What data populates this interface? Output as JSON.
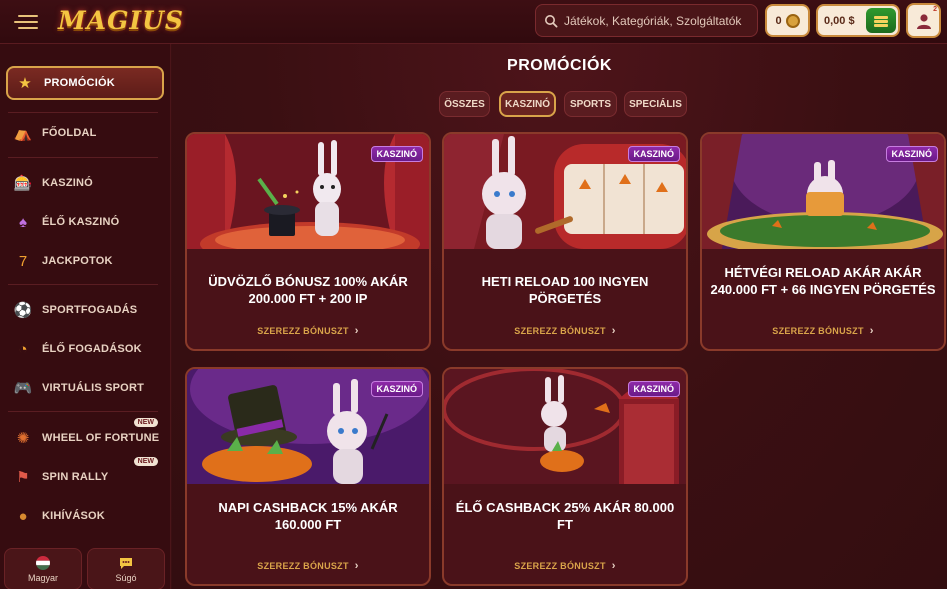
{
  "header": {
    "logo_text": "MAGIUS",
    "search_placeholder": "Játékok, Kategóriák, Szolgáltatók",
    "coins_value": "0",
    "balance": "0,00 $",
    "notification_count": "2"
  },
  "sidebar": {
    "items": [
      {
        "label": "PROMÓCIÓK",
        "icon": "star-hat-icon"
      },
      {
        "label": "FŐOLDAL",
        "icon": "tent-icon"
      },
      {
        "label": "KASZINÓ",
        "icon": "slot-icon"
      },
      {
        "label": "ÉLŐ KASZINÓ",
        "icon": "dealer-icon"
      },
      {
        "label": "JACKPOTOK",
        "icon": "jackpot-icon"
      },
      {
        "label": "SPORTFOGADÁS",
        "icon": "sport-icon"
      },
      {
        "label": "ÉLŐ FOGADÁSOK",
        "icon": "live-bet-icon"
      },
      {
        "label": "VIRTUÁLIS SPORT",
        "icon": "gamepad-icon"
      },
      {
        "label": "WHEEL OF FORTUNE",
        "icon": "wheel-icon",
        "badge": "NEW"
      },
      {
        "label": "SPIN RALLY",
        "icon": "flag-icon",
        "badge": "NEW"
      },
      {
        "label": "KIHÍVÁSOK",
        "icon": "bag-icon"
      }
    ],
    "language_label": "Magyar",
    "help_label": "Súgó"
  },
  "main": {
    "title": "PROMÓCIÓK",
    "tabs": [
      "ÖSSZES",
      "KASZINÓ",
      "SPORTS",
      "SPECIÁLIS"
    ],
    "active_tab": "KASZINÓ",
    "cards": [
      {
        "badge": "KASZINÓ",
        "title": "ÜDVÖZLŐ BÓNUSZ 100% AKÁR 200.000 FT + 200 IP",
        "link": "SZEREZZ BÓNUSZT"
      },
      {
        "badge": "KASZINÓ",
        "title": "HETI RELOAD 100 INGYEN PÖRGETÉS",
        "link": "SZEREZZ BÓNUSZT"
      },
      {
        "badge": "KASZINÓ",
        "title": "HÉTVÉGI RELOAD AKÁR AKÁR 240.000 FT + 66 INGYEN PÖRGETÉS",
        "link": "SZEREZZ BÓNUSZT"
      },
      {
        "badge": "KASZINÓ",
        "title": "NAPI CASHBACK 15% AKÁR 160.000 FT",
        "link": "SZEREZZ BÓNUSZT"
      },
      {
        "badge": "KASZINÓ",
        "title": "ÉLŐ CASHBACK 25% AKÁR 80.000 FT",
        "link": "SZEREZZ BÓNUSZT"
      }
    ]
  },
  "colors": {
    "background": "#3a0f12",
    "accent_gold": "#d9a44a",
    "badge_purple": "#8e2aa8",
    "deposit_green": "#2e9a2e"
  }
}
